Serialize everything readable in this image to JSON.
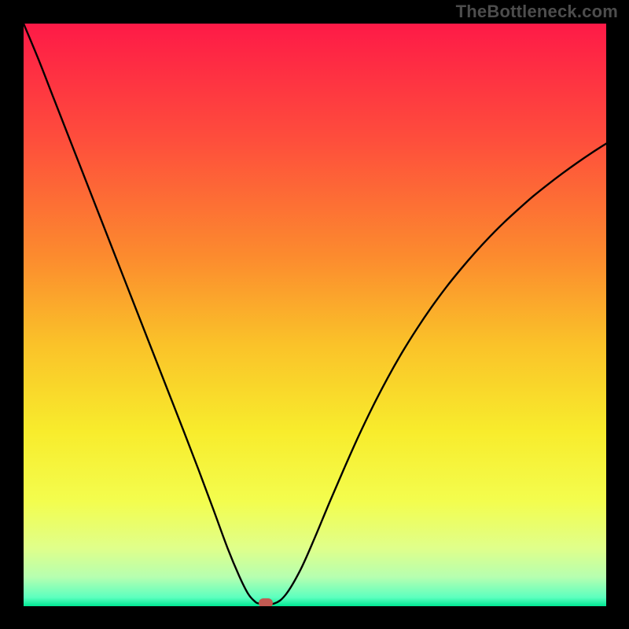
{
  "attribution": "TheBottleneck.com",
  "colors": {
    "frame": "#000000",
    "gradient_stops": [
      {
        "offset": 0.0,
        "color": "#fe1a47"
      },
      {
        "offset": 0.2,
        "color": "#fe4e3c"
      },
      {
        "offset": 0.4,
        "color": "#fc8b2e"
      },
      {
        "offset": 0.55,
        "color": "#fac229"
      },
      {
        "offset": 0.7,
        "color": "#f8ec2c"
      },
      {
        "offset": 0.82,
        "color": "#f3fd4e"
      },
      {
        "offset": 0.9,
        "color": "#e0ff8a"
      },
      {
        "offset": 0.95,
        "color": "#b6ffb0"
      },
      {
        "offset": 0.985,
        "color": "#5cffbf"
      },
      {
        "offset": 1.0,
        "color": "#00e893"
      }
    ],
    "curve": "#000000",
    "marker": "#c25a52"
  },
  "chart_data": {
    "type": "line",
    "title": "",
    "xlabel": "",
    "ylabel": "",
    "xlim": [
      0,
      100
    ],
    "ylim": [
      0,
      100
    ],
    "grid": false,
    "legend": false,
    "marker": {
      "x": 41.5,
      "y": 0.5
    },
    "series": [
      {
        "name": "bottleneck-curve",
        "x": [
          0,
          2.5,
          5,
          7.5,
          10,
          12.5,
          15,
          17.5,
          20,
          22.5,
          25,
          27.5,
          30,
          32.5,
          35,
          37,
          38.5,
          39.6,
          40.5,
          43,
          45,
          47.5,
          50,
          52.5,
          55,
          57.5,
          60,
          62.5,
          65,
          67.5,
          70,
          72.5,
          75,
          77.5,
          80,
          82.5,
          85,
          87.5,
          90,
          92.5,
          95,
          97.5,
          100
        ],
        "values": [
          100,
          94,
          87.6,
          81.2,
          74.8,
          68.4,
          62,
          55.6,
          49.2,
          42.8,
          36.4,
          30,
          23.5,
          16.8,
          10,
          5.2,
          2.2,
          0.9,
          0.45,
          0.45,
          2,
          6.2,
          11.8,
          17.8,
          23.6,
          29.2,
          34.4,
          39.2,
          43.6,
          47.6,
          51.3,
          54.7,
          57.8,
          60.7,
          63.4,
          65.9,
          68.2,
          70.4,
          72.4,
          74.3,
          76.1,
          77.8,
          79.4
        ]
      }
    ]
  }
}
